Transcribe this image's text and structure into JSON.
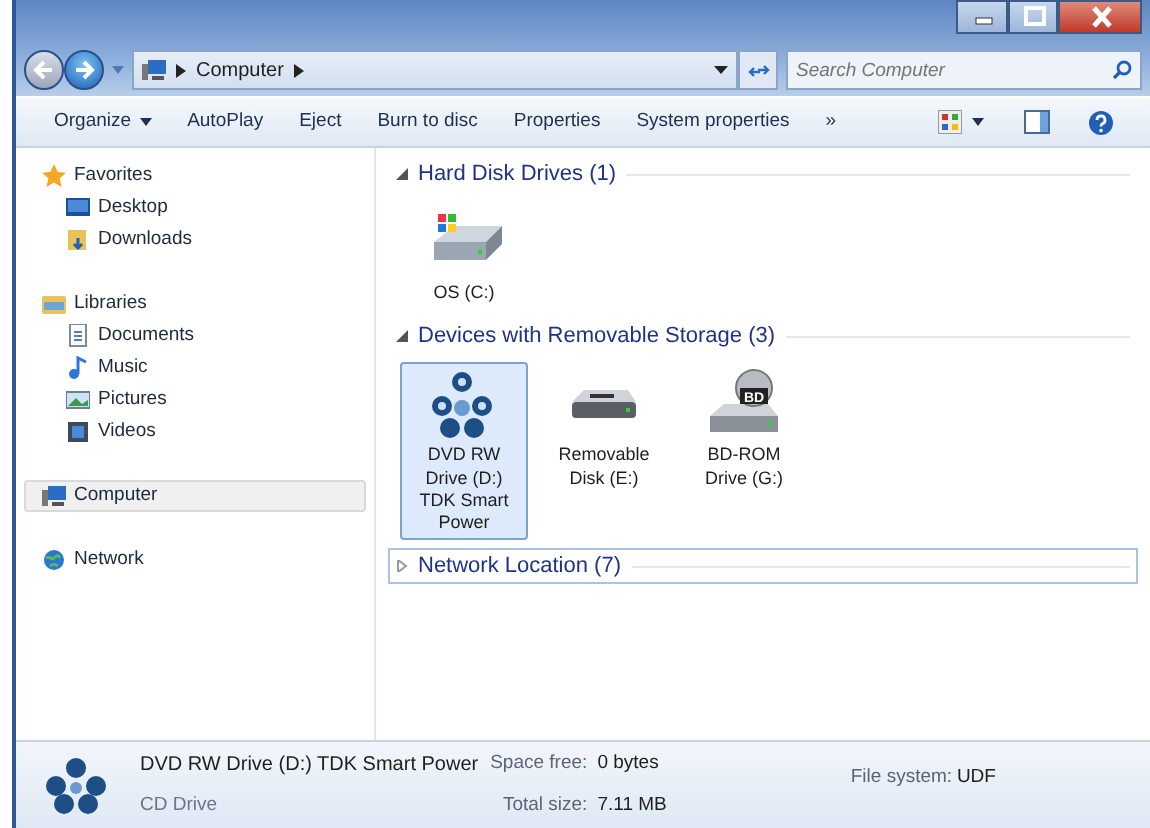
{
  "address_bar": {
    "crumbs": [
      "Computer"
    ],
    "search_placeholder": "Search Computer"
  },
  "toolbar": {
    "items": [
      {
        "label": "Organize",
        "kind": "menu"
      },
      {
        "label": "AutoPlay",
        "kind": "button"
      },
      {
        "label": "Eject",
        "kind": "button"
      },
      {
        "label": "Burn to disc",
        "kind": "button"
      },
      {
        "label": "Properties",
        "kind": "button"
      },
      {
        "label": "System properties",
        "kind": "button"
      },
      {
        "label": "»",
        "kind": "button"
      }
    ]
  },
  "nav_pane": {
    "groups": [
      {
        "label": "Favorites",
        "selected": false,
        "children": [
          {
            "label": "Desktop",
            "selected": false
          },
          {
            "label": "Downloads",
            "selected": false
          }
        ]
      },
      {
        "label": "Libraries",
        "selected": false,
        "children": [
          {
            "label": "Documents",
            "selected": false
          },
          {
            "label": "Music",
            "selected": false
          },
          {
            "label": "Pictures",
            "selected": false
          },
          {
            "label": "Videos",
            "selected": false
          }
        ]
      },
      {
        "label": "Computer",
        "selected": true
      },
      {
        "label": "Network",
        "selected": false
      }
    ]
  },
  "sections": [
    {
      "title": "Hard Disk Drives (1)",
      "expanded": true,
      "focused": false,
      "items": [
        {
          "label": "OS (C:)",
          "kind": "hdd",
          "selected": false
        }
      ]
    },
    {
      "title": "Devices with Removable Storage (3)",
      "expanded": true,
      "focused": false,
      "items": [
        {
          "label": "DVD RW Drive (D:) TDK Smart Power",
          "kind": "dvd",
          "selected": true
        },
        {
          "label": "Removable Disk (E:)",
          "kind": "removable",
          "selected": false
        },
        {
          "label": "BD-ROM Drive (G:)",
          "kind": "bd",
          "badge": "BD",
          "selected": false
        }
      ]
    },
    {
      "title": "Network Location (7)",
      "expanded": false,
      "focused": true
    }
  ],
  "details_pane": {
    "name": "DVD RW Drive (D:) TDK Smart Power",
    "type": "CD Drive",
    "properties": [
      {
        "label": "Space free:",
        "value": "0 bytes"
      },
      {
        "label": "Total size:",
        "value": "7.11 MB"
      },
      {
        "label": "File system:",
        "value": "UDF"
      }
    ]
  }
}
